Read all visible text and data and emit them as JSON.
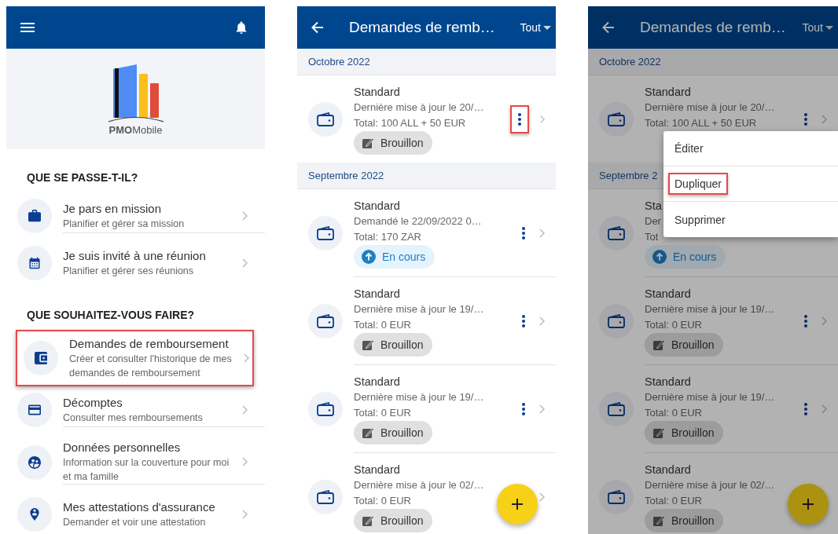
{
  "home_screen": {
    "logo": {
      "text": "**PMO**Mobile"
    },
    "sections": [
      {
        "title": "QUE SE PASSE-T-IL?",
        "items": [
          {
            "kind": "briefcase",
            "title": "Je pars en mission",
            "subtitle": "Planifier et gérer sa mission",
            "highlighted": false
          },
          {
            "kind": "calendar",
            "title": "Je suis invité à une réunion",
            "subtitle": "Planifier et gérer ses réunions",
            "highlighted": false
          }
        ]
      },
      {
        "title": "QUE SOUHAITEZ-VOUS FAIRE?",
        "items": [
          {
            "kind": "wallet",
            "title": "Demandes de remboursement",
            "subtitle": "Créer et consulter l'historique de mes demandes de remboursement",
            "highlighted": true
          },
          {
            "kind": "card",
            "title": "Décomptes",
            "subtitle": "Consulter mes remboursements",
            "highlighted": false
          },
          {
            "kind": "people",
            "title": "Données personnelles",
            "subtitle": "Information sur la couverture pour moi et ma famille",
            "highlighted": false
          },
          {
            "kind": "person-pin",
            "title": "Mes attestations d'assurance",
            "subtitle": "Demander et voir une attestation",
            "highlighted": false
          }
        ]
      }
    ]
  },
  "list_screen": {
    "title": "Demandes de remb…",
    "filter": "Tout",
    "groups": [
      {
        "label": "Octobre 2022",
        "requests": [
          {
            "title": "Standard",
            "line": "Dernière mise à jour le 20/…",
            "total": "Total: 100 ALL + 50 EUR",
            "status": {
              "kind": "draft",
              "label": "Brouillon"
            },
            "more_button": true,
            "more_highlighted": true,
            "chevron": true
          }
        ]
      },
      {
        "label": "Septembre 2022",
        "requests": [
          {
            "title": "Standard",
            "line": "Demandé le 22/09/2022 0…",
            "total": "Total: 170 ZAR",
            "status": {
              "kind": "in_progress",
              "label": "En cours"
            },
            "more_button": true,
            "more_highlighted": false,
            "chevron": true
          },
          {
            "title": "Standard",
            "line": "Dernière mise à jour le 19/…",
            "total": "Total: 0 EUR",
            "status": {
              "kind": "draft",
              "label": "Brouillon"
            },
            "more_button": true,
            "more_highlighted": false,
            "chevron": true
          },
          {
            "title": "Standard",
            "line": "Dernière mise à jour le 19/…",
            "total": "Total: 0 EUR",
            "status": {
              "kind": "draft",
              "label": "Brouillon"
            },
            "more_button": true,
            "more_highlighted": false,
            "chevron": true
          },
          {
            "title": "Standard",
            "line": "Dernière mise à jour le 02/…",
            "total": "Total: 0 EUR",
            "status": {
              "kind": "draft",
              "label": "Brouillon"
            },
            "more_button": false,
            "chevron": true
          }
        ]
      }
    ]
  },
  "menu_screen": {
    "title": "Demandes de remb…",
    "filter": "Tout",
    "dimmed": true,
    "groups": [
      {
        "label": "Octobre 2022",
        "requests": [
          {
            "title": "Standard",
            "line": "Dernière mise à jour le 20/…",
            "total": "Total: 100 ALL + 50 EUR",
            "more_button": true,
            "more_highlighted": false,
            "chevron": true
          }
        ]
      },
      {
        "label": "Septembre 2",
        "requests": [
          {
            "title": "Sta",
            "line": "Der",
            "total": "Tot",
            "status": {
              "kind": "in_progress",
              "label": "En cours"
            },
            "more_button": false,
            "chevron": false
          },
          {
            "title": "Standard",
            "line": "Dernière mise à jour le 19/…",
            "total": "Total: 0 EUR",
            "status": {
              "kind": "draft",
              "label": "Brouillon"
            },
            "more_button": true,
            "more_highlighted": false,
            "chevron": true
          },
          {
            "title": "Standard",
            "line": "Dernière mise à jour le 19/…",
            "total": "Total: 0 EUR",
            "status": {
              "kind": "draft",
              "label": "Brouillon"
            },
            "more_button": true,
            "more_highlighted": false,
            "chevron": true
          },
          {
            "title": "Standard",
            "line": "Dernière mise à jour le 02/…",
            "total": "Total: 0 EUR",
            "status": {
              "kind": "draft",
              "label": "Brouillon"
            },
            "more_button": false,
            "chevron": false
          }
        ]
      }
    ],
    "menu": [
      {
        "label": "Éditer",
        "highlighted": false
      },
      {
        "label": "Dupliquer",
        "highlighted": true
      },
      {
        "label": "Supprimer",
        "highlighted": false
      }
    ]
  }
}
